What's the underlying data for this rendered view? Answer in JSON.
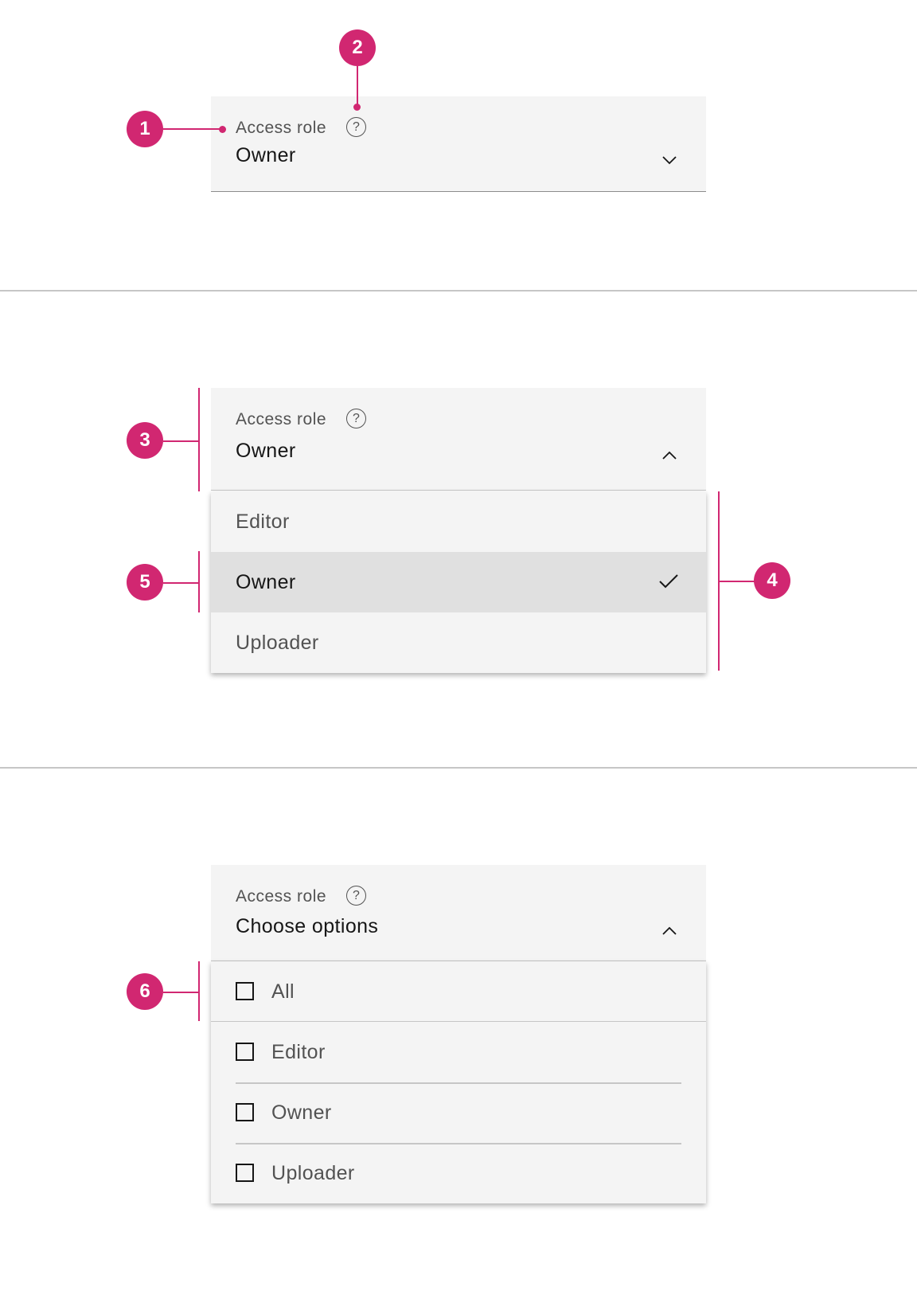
{
  "accent_color": "#d12771",
  "example1": {
    "label": "Access role",
    "help_icon": "question-circle-icon",
    "value": "Owner",
    "chevron": "chevron-down-icon"
  },
  "example2": {
    "label": "Access role",
    "value": "Owner",
    "chevron": "chevron-up-icon",
    "options": [
      {
        "label": "Editor"
      },
      {
        "label": "Owner",
        "selected": true
      },
      {
        "label": "Uploader"
      }
    ]
  },
  "example3": {
    "label": "Access role",
    "value": "Choose options",
    "chevron": "chevron-up-icon",
    "options": [
      {
        "label": "All",
        "checked": false
      },
      {
        "label": "Editor",
        "checked": false
      },
      {
        "label": "Owner",
        "checked": false
      },
      {
        "label": "Uploader",
        "checked": false
      }
    ]
  },
  "markers": [
    "1",
    "2",
    "3",
    "4",
    "5",
    "6"
  ]
}
